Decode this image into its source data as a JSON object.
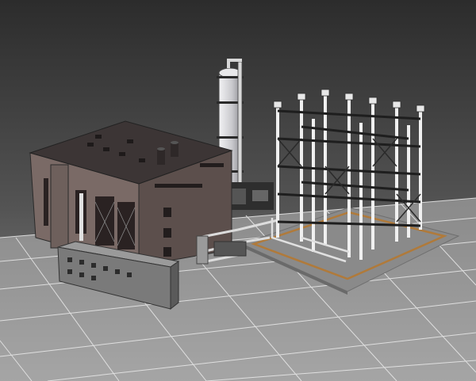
{
  "scene": {
    "subject": "industrial-plant-render",
    "colors": {
      "bg_top": "#2c2c2c",
      "bg_bottom": "#8c8c8c",
      "ground": "#b9b9b9",
      "grid": "#e8e8e8",
      "brick_light": "#7a6a66",
      "brick_dark": "#5c4f4c",
      "roof": "#3c3535",
      "annex": "#8e8e8e",
      "annex_side": "#6f6f6f",
      "pad": "#8a8a8a",
      "pad_stripe": "#b07a3a",
      "steel": "#e6e6e6",
      "steel_dark": "#2a2a2a",
      "column": "#d2d2d6"
    },
    "icons": [
      "building-icon",
      "distillation-column-icon",
      "pipe-rack-icon"
    ]
  }
}
